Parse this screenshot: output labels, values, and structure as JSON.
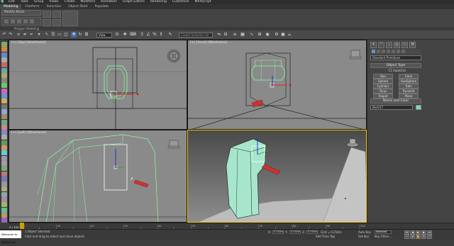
{
  "menubar": {
    "items": [
      "Edit",
      "Tools",
      "Group",
      "Views",
      "Create",
      "Modifiers",
      "Animation",
      "Graph Editors",
      "Rendering",
      "Customize",
      "MAXScript"
    ]
  },
  "ribbon": {
    "tabs": [
      "Modeling",
      "Freeform",
      "Selection",
      "Object Paint",
      "Populate"
    ],
    "modify_mode_label": "Modify Mode",
    "polymodel_label": "Polygon Modeling"
  },
  "toolbar": {
    "view_dropdown": "View",
    "selection_set_placeholder": "Create Selection Se"
  },
  "viewports": {
    "top": "[+] [Top] [Wireframe]",
    "front": "[+] [Front] [Wireframe]",
    "left": "[+] [Left] [Wireframe]",
    "perspective": "[+] [Perspective] [Shaded + Edged Faces]"
  },
  "command_panel": {
    "category_dropdown": "Standard Primitives",
    "object_type_title": "Object Type",
    "autogrid_label": "AutoGrid",
    "object_buttons": [
      "Box",
      "Cone",
      "Sphere",
      "GeoSphere",
      "Cylinder",
      "Tube",
      "Torus",
      "Pyramid",
      "Teapot",
      "Plane"
    ],
    "name_color_title": "Name and Color",
    "name_value": "Box017",
    "object_color": "#7fd4c0"
  },
  "timeline": {
    "frame_display": "0 / 100",
    "ticks": [
      "0",
      "10",
      "20",
      "30",
      "40",
      "50",
      "60",
      "70",
      "80",
      "90",
      "100"
    ]
  },
  "status": {
    "maxscript_label": "Welcome to MAXScript",
    "selection_text": "1 Object Selected",
    "prompt_text": "Click and drag to select and move objects",
    "x_label": "X:",
    "x_value": "0.000m",
    "y_label": "Y:",
    "y_value": "0.000m",
    "z_label": "Z:",
    "z_value": "0.000m",
    "grid_text": "Grid = 0.254m",
    "add_time_tag": "Add Time Tag",
    "autokey_label": "Auto Key",
    "autokey_mode": "Selected",
    "setkey_label": "Set Key",
    "key_filters_label": "Key Filters..."
  },
  "colors": {
    "accent_active_viewport": "#f2c200",
    "object_fill": "#a6e6cc",
    "wireframe": "#8cff9e",
    "wire_selected": "#ffffff"
  }
}
